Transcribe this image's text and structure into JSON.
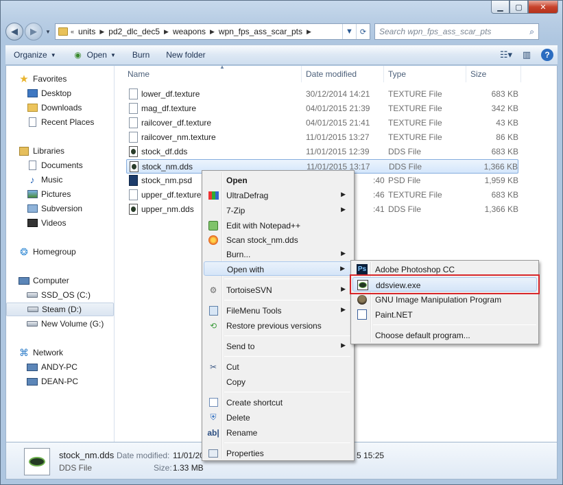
{
  "window": {
    "caption_buttons": [
      "minimize",
      "maximize",
      "close"
    ]
  },
  "address": {
    "segments": [
      "units",
      "pd2_dlc_dec5",
      "weapons",
      "wpn_fps_ass_scar_pts"
    ],
    "overflow": "«",
    "search_placeholder": "Search wpn_fps_ass_scar_pts"
  },
  "toolbar": {
    "organize": "Organize",
    "open": "Open",
    "burn": "Burn",
    "new_folder": "New folder"
  },
  "nav": {
    "favorites": "Favorites",
    "desktop": "Desktop",
    "downloads": "Downloads",
    "recent_places": "Recent Places",
    "libraries": "Libraries",
    "documents": "Documents",
    "music": "Music",
    "pictures": "Pictures",
    "subversion": "Subversion",
    "videos": "Videos",
    "homegroup": "Homegroup",
    "computer": "Computer",
    "ssd_os": "SSD_OS (C:)",
    "steam": "Steam (D:)",
    "new_volume": "New Volume (G:)",
    "network": "Network",
    "andy_pc": "ANDY-PC",
    "dean_pc": "DEAN-PC"
  },
  "columns": {
    "name": "Name",
    "date": "Date modified",
    "type": "Type",
    "size": "Size"
  },
  "files": [
    {
      "name": "lower_df.texture",
      "date": "30/12/2014 14:21",
      "type": "TEXTURE File",
      "size": "683 KB",
      "icon": "generic"
    },
    {
      "name": "mag_df.texture",
      "date": "04/01/2015 21:39",
      "type": "TEXTURE File",
      "size": "342 KB",
      "icon": "generic"
    },
    {
      "name": "railcover_df.texture",
      "date": "04/01/2015 21:41",
      "type": "TEXTURE File",
      "size": "43 KB",
      "icon": "generic"
    },
    {
      "name": "railcover_nm.texture",
      "date": "11/01/2015 13:27",
      "type": "TEXTURE File",
      "size": "86 KB",
      "icon": "generic"
    },
    {
      "name": "stock_df.dds",
      "date": "11/01/2015 12:39",
      "type": "DDS File",
      "size": "683 KB",
      "icon": "dds"
    },
    {
      "name": "stock_nm.dds",
      "date": "11/01/2015 13:17",
      "type": "DDS File",
      "size": "1,366 KB",
      "icon": "dds",
      "selected": true
    },
    {
      "name": "stock_nm.psd",
      "date": ":40",
      "type": "PSD File",
      "size": "1,959 KB",
      "icon": "psd"
    },
    {
      "name": "upper_df.texture",
      "date": ":46",
      "type": "TEXTURE File",
      "size": "683 KB",
      "icon": "generic"
    },
    {
      "name": "upper_nm.dds",
      "date": ":41",
      "type": "DDS File",
      "size": "1,366 KB",
      "icon": "dds"
    }
  ],
  "status": {
    "name": "stock_nm.dds",
    "type": "DDS File",
    "date_label": "Date modified:",
    "date_value": "11/01/2015 13:17",
    "date_tail": "5 15:25",
    "size_label": "Size:",
    "size_value": "1.33 MB"
  },
  "context_menu": {
    "open": "Open",
    "ultradefrag": "UltraDefrag",
    "seven_zip": "7-Zip",
    "notepadpp": "Edit with Notepad++",
    "scan": "Scan stock_nm.dds",
    "burn": "Burn...",
    "open_with": "Open with",
    "tortoisesvn": "TortoiseSVN",
    "filemenu_tools": "FileMenu Tools",
    "restore": "Restore previous versions",
    "send_to": "Send to",
    "cut": "Cut",
    "copy": "Copy",
    "create_shortcut": "Create shortcut",
    "delete": "Delete",
    "rename": "Rename",
    "properties": "Properties"
  },
  "open_with_menu": {
    "photoshop": "Adobe Photoshop CC",
    "ddsview": "ddsview.exe",
    "gimp": "GNU Image Manipulation Program",
    "paintnet": "Paint.NET",
    "choose": "Choose default program..."
  },
  "colors": {
    "highlight_box": "#d8262a",
    "selection": "#d4e6fb",
    "menu_bg": "#f0f0f0"
  }
}
